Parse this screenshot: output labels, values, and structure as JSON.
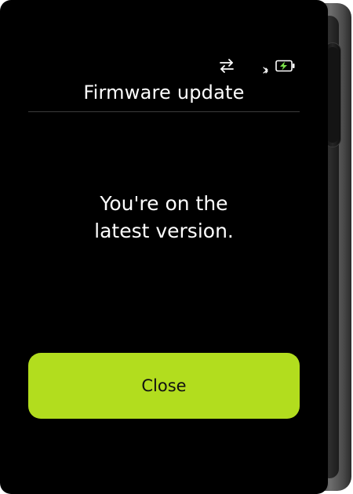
{
  "screen": {
    "title": "Firmware update",
    "message_lines": [
      "You're on the",
      "latest version."
    ],
    "close_label": "Close"
  },
  "status_bar": {
    "icons": [
      "usb-transfer-icon",
      "bluetooth-icon",
      "battery-charging-icon"
    ]
  },
  "colors": {
    "background": "#000000",
    "accent": "#b2dd1e",
    "text": "#ffffff",
    "battery_charge": "#7be24a"
  }
}
